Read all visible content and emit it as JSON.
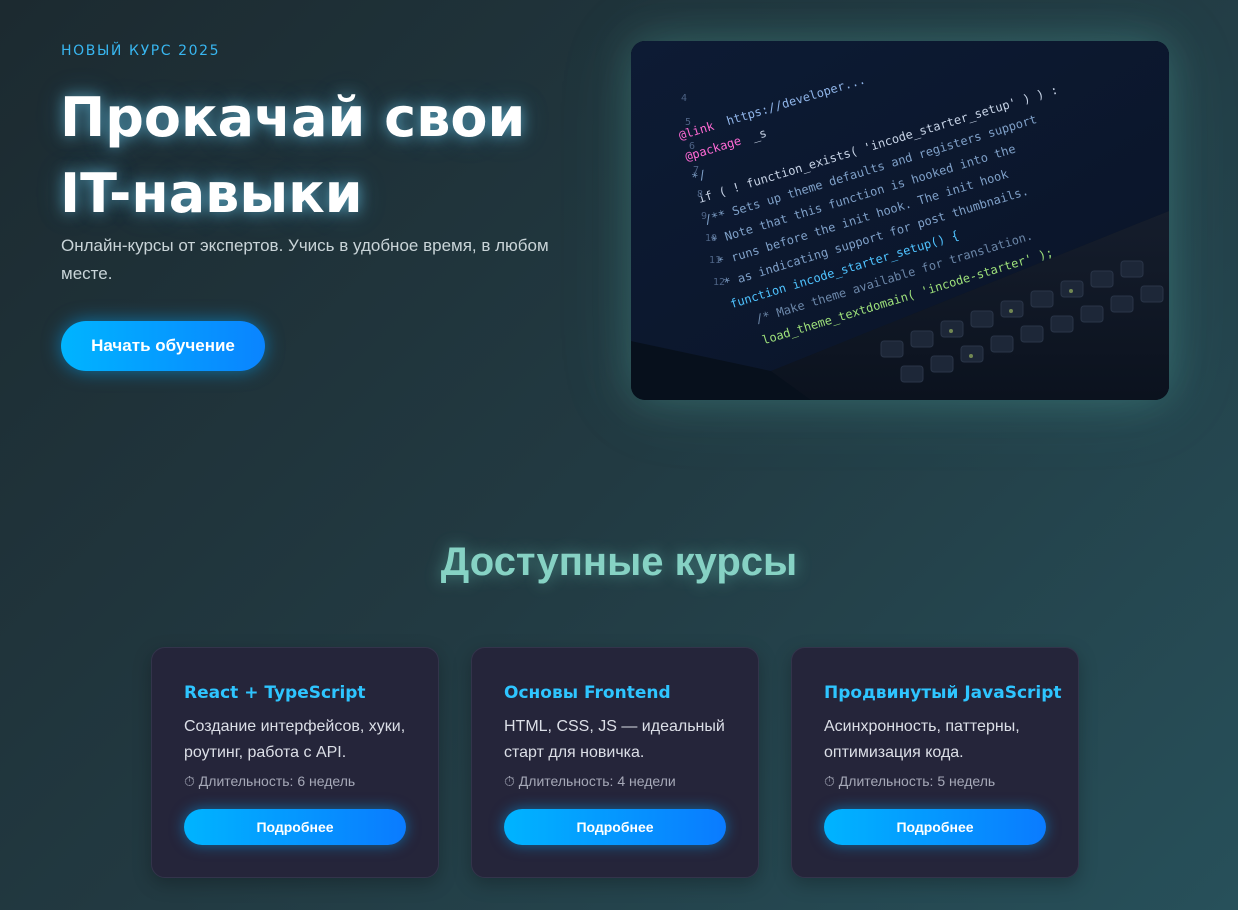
{
  "hero": {
    "eyebrow": "НОВЫЙ КУРС 2025",
    "title_line1": "Прокачай свои",
    "title_line2": "IT-навыки",
    "subtitle": "Онлайн-курсы от экспертов. Учись в удобное время, в любом месте.",
    "cta_label": "Начать обучение",
    "image": "laptop-code-photo"
  },
  "courses": {
    "section_title": "Доступные курсы",
    "items": [
      {
        "title": "React + TypeScript",
        "description": "Создание интерфейсов, хуки, роутинг, работа с API.",
        "duration_icon": "stopwatch-icon",
        "duration": "⏱ Длительность: 6 недель",
        "button_label": "Подробнее"
      },
      {
        "title": "Основы Frontend",
        "description": "HTML, CSS, JS — идеальный старт для новичка.",
        "duration_icon": "stopwatch-icon",
        "duration": "⏱ Длительность: 4 недели",
        "button_label": "Подробнее"
      },
      {
        "title": "Продвинутый JavaScript",
        "description": "Асинхронность, паттерны, оптимизация кода.",
        "duration_icon": "stopwatch-icon",
        "duration": "⏱ Длительность: 5 недель",
        "button_label": "Подробнее"
      }
    ]
  },
  "colors": {
    "accent": "#00b4ff",
    "heading_glow": "#86d2c4",
    "card_title": "#2ec5ff",
    "card_bg": "#25253a"
  }
}
